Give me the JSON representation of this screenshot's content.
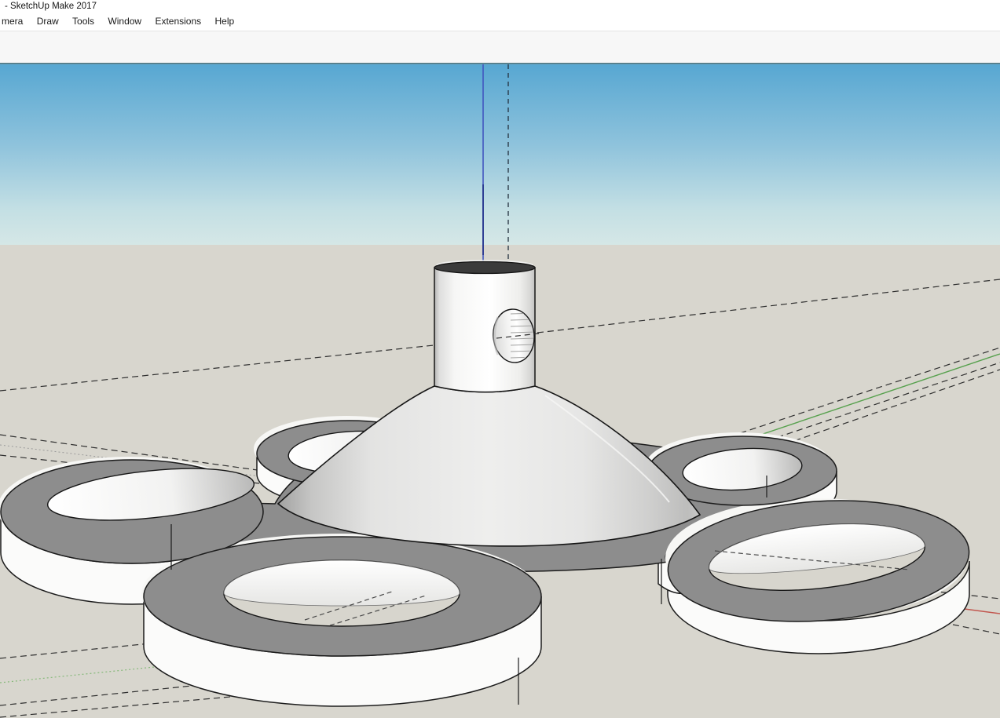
{
  "window": {
    "title": "- SketchUp Make 2017"
  },
  "menu": {
    "items": [
      "mera",
      "Draw",
      "Tools",
      "Window",
      "Extensions",
      "Help"
    ]
  },
  "toolbar": {
    "buttons": [
      {
        "name": "tool-caret-partial",
        "state": "normal"
      },
      {
        "name": "arc-tool-button",
        "state": "normal"
      },
      {
        "name": "arc-caret",
        "state": "normal"
      },
      {
        "name": "circle-tool-button",
        "state": "normal"
      },
      {
        "name": "circle-caret",
        "state": "normal"
      },
      {
        "name": "push-pull-button",
        "state": "normal"
      },
      {
        "name": "follow-me-button",
        "state": "normal"
      },
      {
        "name": "move-button",
        "state": "normal"
      },
      {
        "name": "rotate-button",
        "state": "normal"
      },
      {
        "name": "scale-button",
        "state": "normal"
      },
      {
        "name": "tape-measure-button",
        "state": "normal"
      },
      {
        "name": "text-button",
        "state": "normal"
      },
      {
        "name": "paint-bucket-button",
        "state": "normal"
      },
      {
        "name": "orbit-button",
        "state": "active"
      },
      {
        "name": "pan-button",
        "state": "normal"
      },
      {
        "name": "zoom-button",
        "state": "normal"
      },
      {
        "name": "zoom-extents-button",
        "state": "normal"
      },
      {
        "name": "warehouse-model-button",
        "state": "normal"
      },
      {
        "name": "share-model-button",
        "state": "normal"
      },
      {
        "name": "share-component-button",
        "state": "disabled"
      },
      {
        "name": "extension-warehouse-button",
        "state": "normal"
      },
      {
        "name": "add-location-button",
        "state": "normal"
      },
      {
        "name": "outer-shell-button",
        "state": "normal"
      },
      {
        "name": "intersect-button",
        "state": "disabled"
      },
      {
        "name": "union-button",
        "state": "disabled"
      },
      {
        "name": "subtract-button",
        "state": "disabled"
      },
      {
        "name": "trim-button",
        "state": "disabled"
      },
      {
        "name": "split-button",
        "state": "disabled"
      },
      {
        "name": "shape-box-button",
        "state": "normal"
      },
      {
        "name": "shape-wedge-button",
        "state": "normal"
      },
      {
        "name": "shape-prism-button",
        "state": "normal"
      },
      {
        "name": "shape-pyramid-button",
        "state": "normal"
      },
      {
        "name": "shape-dome-button",
        "state": "normal"
      },
      {
        "name": "shape-sphere-button",
        "state": "normal"
      },
      {
        "name": "shape-cylinder-button",
        "state": "normal"
      },
      {
        "name": "shape-cone-button",
        "state": "normal"
      },
      {
        "name": "shape-partial-button",
        "state": "normal"
      }
    ]
  },
  "viewport": {
    "axes": {
      "blue": "#4256bf",
      "green": "#57a14e",
      "red": "#c2574f"
    },
    "colors": {
      "sky_top": "#57a7d2",
      "sky_horizon": "#d5e7e6",
      "ground": "#d8d6ce",
      "face_white": "#fbfbfa",
      "top_face_gray": "#8d8d8d",
      "edge": "#1c1c1c"
    },
    "model": {
      "description": "white plate with five ring cutouts, center cone and cylindrical hub with side hole"
    }
  }
}
